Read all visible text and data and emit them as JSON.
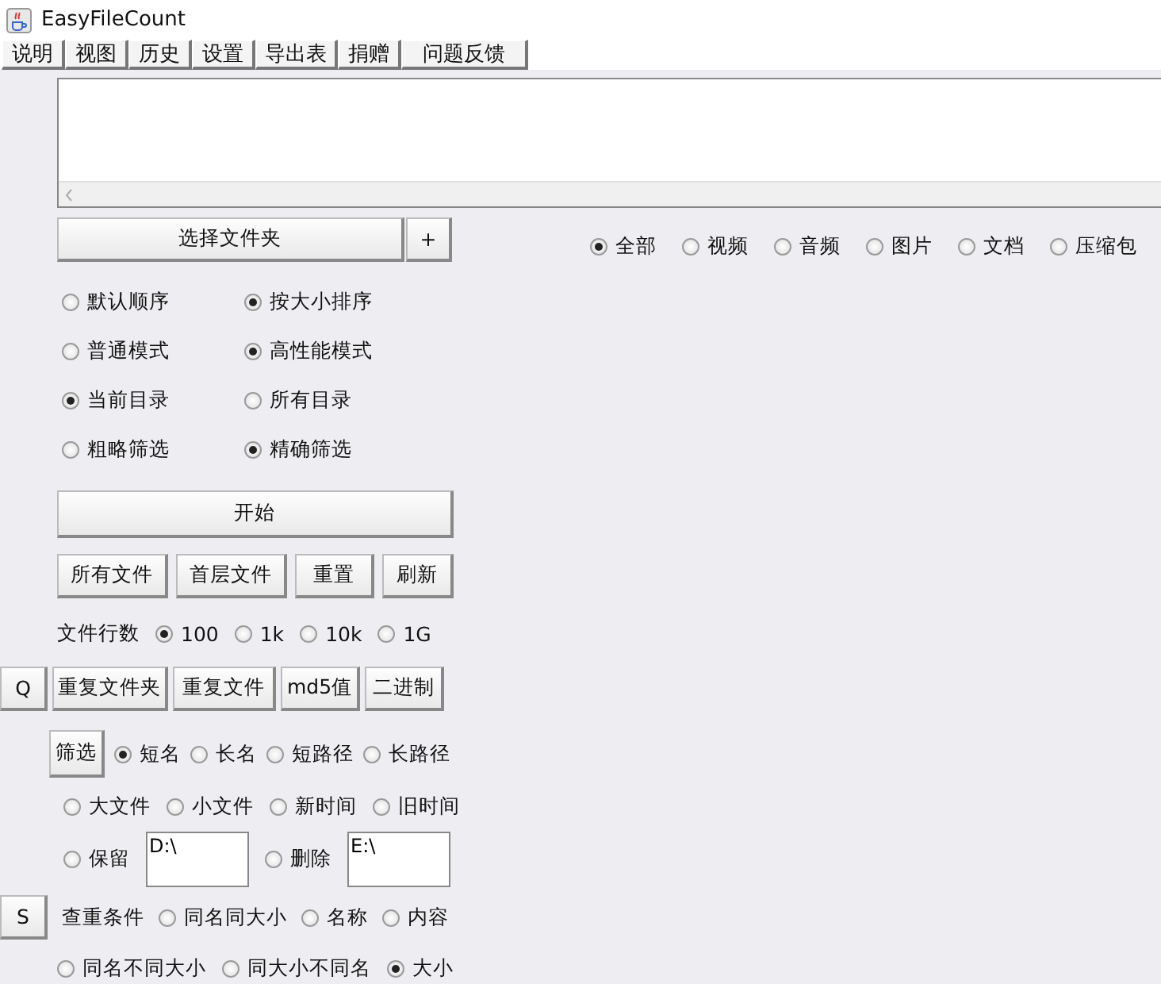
{
  "window": {
    "title": "EasyFileCount"
  },
  "menu": [
    "说明",
    "视图",
    "历史",
    "设置",
    "导出表",
    "捐赠",
    "问题反馈"
  ],
  "folder_buttons": [
    "选择文件夹",
    "+"
  ],
  "type_filter": [
    {
      "label": "全部",
      "selected": true
    },
    {
      "label": "视频",
      "selected": false
    },
    {
      "label": "音频",
      "selected": false
    },
    {
      "label": "图片",
      "selected": false
    },
    {
      "label": "文档",
      "selected": false
    },
    {
      "label": "压缩包",
      "selected": false
    }
  ],
  "options": [
    [
      {
        "label": "默认顺序",
        "selected": false
      },
      {
        "label": "按大小排序",
        "selected": true
      }
    ],
    [
      {
        "label": "普通模式",
        "selected": false
      },
      {
        "label": "高性能模式",
        "selected": true
      }
    ],
    [
      {
        "label": "当前目录",
        "selected": true
      },
      {
        "label": "所有目录",
        "selected": false
      }
    ],
    [
      {
        "label": "粗略筛选",
        "selected": false
      },
      {
        "label": "精确筛选",
        "selected": true
      }
    ]
  ],
  "start_button": "开始",
  "list_buttons": [
    "所有文件",
    "首层文件",
    "重置",
    "刷新"
  ],
  "file_lines": {
    "label": "文件行数",
    "options": [
      {
        "label": "100",
        "selected": true
      },
      {
        "label": "1k",
        "selected": false
      },
      {
        "label": "10k",
        "selected": false
      },
      {
        "label": "1G",
        "selected": false
      }
    ]
  },
  "duplicate": {
    "toggle": "Q",
    "buttons": [
      "重复文件夹",
      "重复文件",
      "md5值",
      "二进制"
    ]
  },
  "filter": {
    "button": "筛选",
    "name_options": [
      {
        "label": "短名",
        "selected": true
      },
      {
        "label": "长名",
        "selected": false
      },
      {
        "label": "短路径",
        "selected": false
      },
      {
        "label": "长路径",
        "selected": false
      }
    ],
    "sort_options": [
      {
        "label": "大文件",
        "selected": false
      },
      {
        "label": "小文件",
        "selected": false
      },
      {
        "label": "新时间",
        "selected": false
      },
      {
        "label": "旧时间",
        "selected": false
      }
    ],
    "keep": {
      "label": "保留",
      "selected": false,
      "value": "D:\\"
    },
    "delete": {
      "label": "删除",
      "selected": false,
      "value": "E:\\"
    }
  },
  "criteria": {
    "toggle": "S",
    "label": "查重条件",
    "rows": [
      [
        {
          "label": "同名同大小",
          "selected": false
        },
        {
          "label": "名称",
          "selected": false
        },
        {
          "label": "内容",
          "selected": false
        }
      ],
      [
        {
          "label": "同名不同大小",
          "selected": false
        },
        {
          "label": "同大小不同名",
          "selected": false
        },
        {
          "label": "大小",
          "selected": true
        }
      ]
    ]
  }
}
